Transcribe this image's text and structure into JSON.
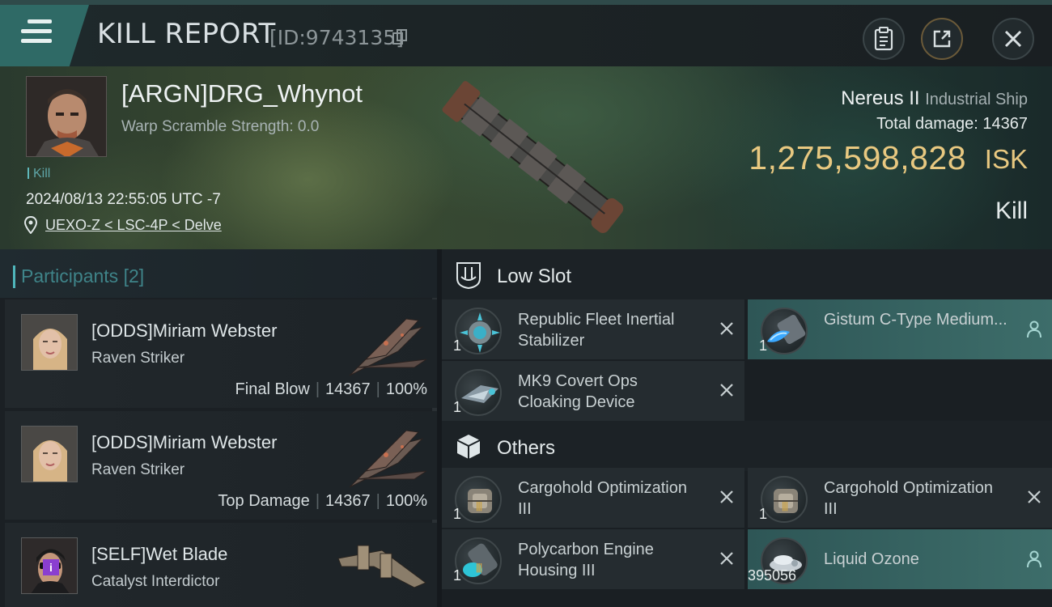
{
  "header": {
    "title": "KILL REPORT",
    "id_text": "[ID:9743135]"
  },
  "victim": {
    "name": "[ARGN]DRG_Whynot",
    "warp_scramble": "Warp Scramble Strength: 0.0",
    "kill_tag": "Kill",
    "timestamp": "2024/08/13 22:55:05 UTC -7",
    "location": "UEXO-Z < LSC-4P < Delve",
    "ship_name": "Nereus II",
    "ship_class": "Industrial Ship",
    "total_damage_label": "Total damage:",
    "total_damage": "14367",
    "isk_value": "1,275,598,828",
    "isk_unit": "ISK",
    "result": "Kill"
  },
  "participants": {
    "label": "Participants",
    "count": "[2]",
    "rows": [
      {
        "name": "[ODDS]Miriam Webster",
        "ship": "Raven Striker",
        "role": "Final Blow",
        "damage": "14367",
        "percent": "100%"
      },
      {
        "name": "[ODDS]Miriam Webster",
        "ship": "Raven Striker",
        "role": "Top Damage",
        "damage": "14367",
        "percent": "100%"
      },
      {
        "name": "[SELF]Wet Blade",
        "ship": "Catalyst Interdictor"
      }
    ]
  },
  "fitting": {
    "low_slot": {
      "label": "Low Slot",
      "items": [
        {
          "name": "Republic Fleet Inertial Stabilizer",
          "qty": "1"
        },
        {
          "name": "Gistum C-Type Medium...",
          "qty": "1"
        },
        {
          "name": "MK9 Covert Ops Cloaking Device",
          "qty": "1"
        }
      ]
    },
    "others": {
      "label": "Others",
      "items": [
        {
          "name": "Cargohold Optimization III",
          "qty": "1"
        },
        {
          "name": "Cargohold Optimization III",
          "qty": "1"
        },
        {
          "name": "Polycarbon Engine Housing III",
          "qty": "1"
        },
        {
          "name": "Liquid Ozone",
          "qty": "395056"
        }
      ]
    }
  },
  "icons": {
    "menu": "menu-icon",
    "copy": "copy-icon",
    "clipboard": "clipboard-icon",
    "share": "share-icon",
    "close": "close-icon",
    "pin": "location-pin-icon",
    "low_slot": "low-slot-icon",
    "others": "cube-icon",
    "remove": "close-x-icon",
    "person": "person-icon",
    "info": "info-badge-icon"
  },
  "colors": {
    "accent_teal": "#4fb6bb",
    "isk_gold": "#e8c880",
    "highlight_row": "#3d6d6a",
    "info_badge": "#8a3ed0"
  }
}
